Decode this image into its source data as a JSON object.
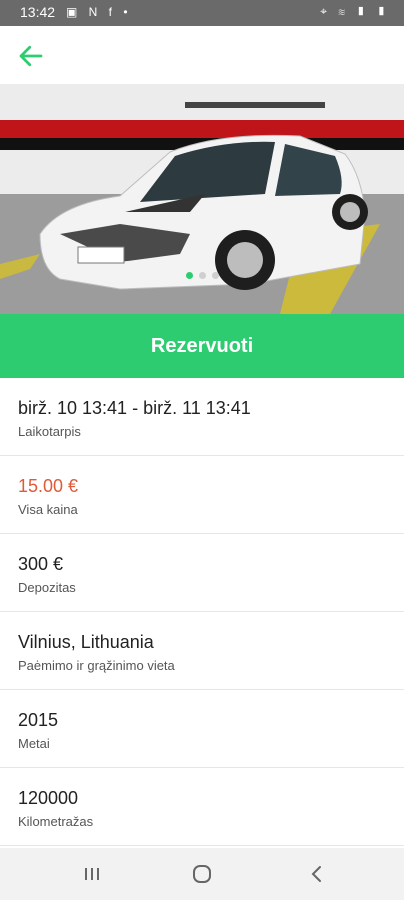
{
  "status_bar": {
    "time": "13:42",
    "left_icons": "▣ N f •",
    "right_icons": "⌖ ≋ ▮ ▮"
  },
  "reserve_button": {
    "label": "Rezervuoti"
  },
  "details": [
    {
      "value": "birž. 10 13:41 - birž. 11 13:41",
      "label": "Laikotarpis"
    },
    {
      "value": "15.00 €",
      "label": "Visa kaina"
    },
    {
      "value": "300 €",
      "label": "Depozitas"
    },
    {
      "value": "Vilnius, Lithuania",
      "label": "Paėmimo ir grąžinimo vieta"
    },
    {
      "value": "2015",
      "label": "Metai"
    },
    {
      "value": "120000",
      "label": "Kilometražas"
    }
  ],
  "colors": {
    "accent": "#2ecc71",
    "price": "#e05a3a"
  }
}
